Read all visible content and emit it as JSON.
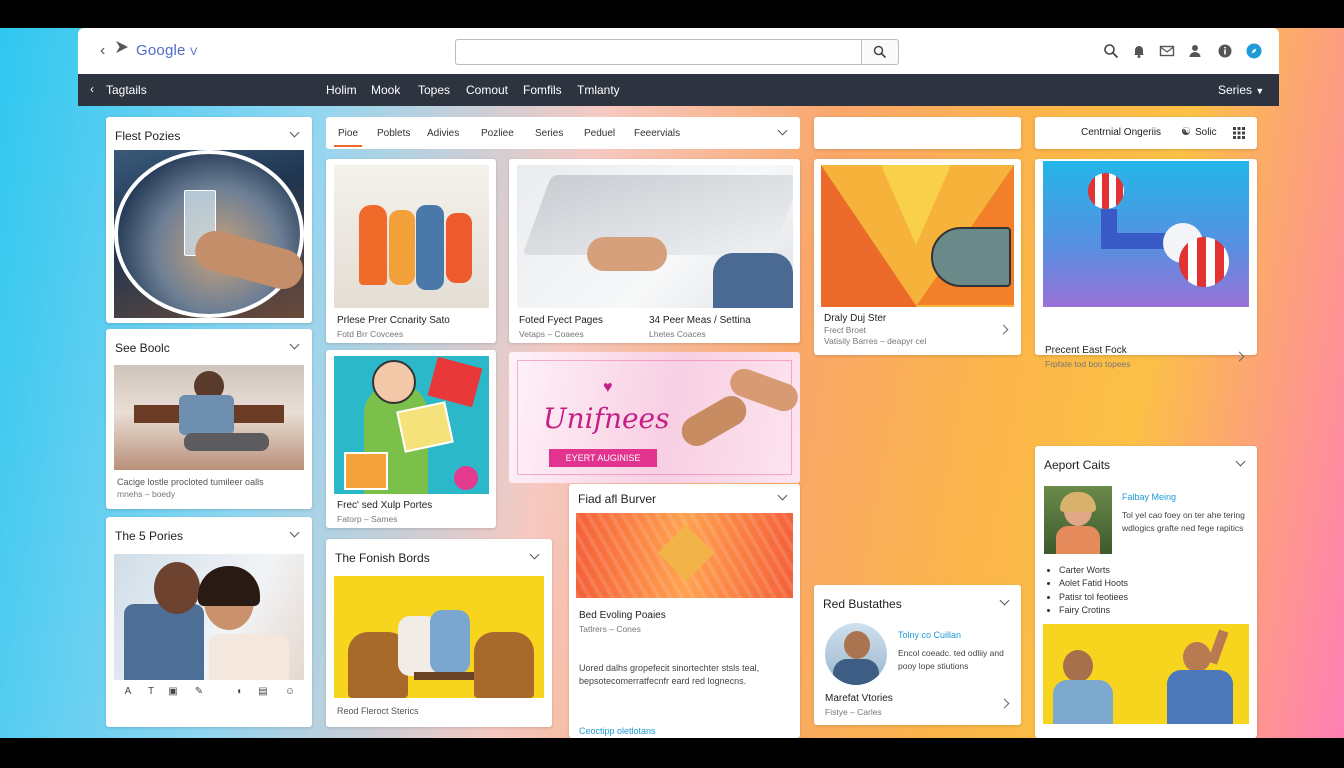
{
  "browser": {
    "logo": "Google",
    "logo_suffix": "V",
    "search_value": "",
    "icons": [
      "search-icon",
      "bell-icon",
      "mail-icon",
      "user-icon",
      "info-icon",
      "compass-icon"
    ]
  },
  "menu": {
    "back_label": "Tagtails",
    "items": [
      "Holim",
      "Mook",
      "Topes",
      "Comout",
      "Fomfils",
      "Tmlanty"
    ],
    "right_label": "Series"
  },
  "left_col": {
    "card1": {
      "title": "Flest Pozies"
    },
    "card2": {
      "title": "See Boolc",
      "caption": "Cacige lostle procloted tumileer oalls",
      "sub": "mnehs – boedy"
    },
    "card3": {
      "title": "The 5 Pories"
    }
  },
  "tabs": [
    "Pioe",
    "Poblets",
    "Adivies",
    "Pozliee",
    "Series",
    "Peduel",
    "Feeervials"
  ],
  "mid": {
    "c1": {
      "title": "Prlese Prer Ccnarity Sato",
      "sub": "Fotd Brr Covcees"
    },
    "c2": {
      "title1": "Foted Fyect Pages",
      "sub1": "Vetaps – Coaees",
      "title2": "34 Peer Meas / Settina",
      "sub2": "Lhetes Coaces"
    },
    "c3": {
      "title": "Frec' sed Xulp Portes",
      "sub": "Fatorp – Sames"
    },
    "banner": {
      "headline": "Unifnees",
      "button": "EYERT AUGINISE"
    },
    "c4": {
      "title": "The Fonish Bords",
      "caption": "Reod Fleroct Sterics"
    },
    "c5": {
      "title": "Fiad afl Burver",
      "cap1": "Bed Evoling Poaies",
      "sub1": "Tatlrers – Cones",
      "body": "Uored dalhs gropefecit sinortechter stsls teal, bepsotecomerratfecnfr eard red lognecns.",
      "link": "Ceoctipp oletlotans"
    }
  },
  "right_mid": {
    "c1": {
      "title": "Draly Duj Ster",
      "sub1": "Frect Broet",
      "sub2": "Vatisily Barres – deapyr cel"
    },
    "c2": {
      "title": "Red Bustathes",
      "link": "Tolny co Cuillan",
      "body": "Encol coeadc. ted odliiy and pooy lope stiutions",
      "caption": "Marefat Vtories",
      "sub": "Fistye – Carles"
    }
  },
  "right_col": {
    "header": {
      "label": "Centrnial Ongeriis",
      "btn": "Solic"
    },
    "c1": {
      "title": "Precent East Fock",
      "sub": "Frpfate tod boo topees"
    },
    "c2": {
      "title": "Aeport Caits",
      "link": "Falbay Meing",
      "body": "Tol yel cao foey on ter ahe tering wdlogics grafte ned fege rapitics",
      "bullets": [
        "Carter Worts",
        "Aolet Fatid Hoots",
        "Patisr tol feotiees",
        "Fairy Crotins"
      ]
    }
  },
  "colors": {
    "menu_bg": "#2d3440",
    "accent": "#f2672a",
    "link": "#1e9bd7",
    "banner_pink": "#e2338f"
  }
}
